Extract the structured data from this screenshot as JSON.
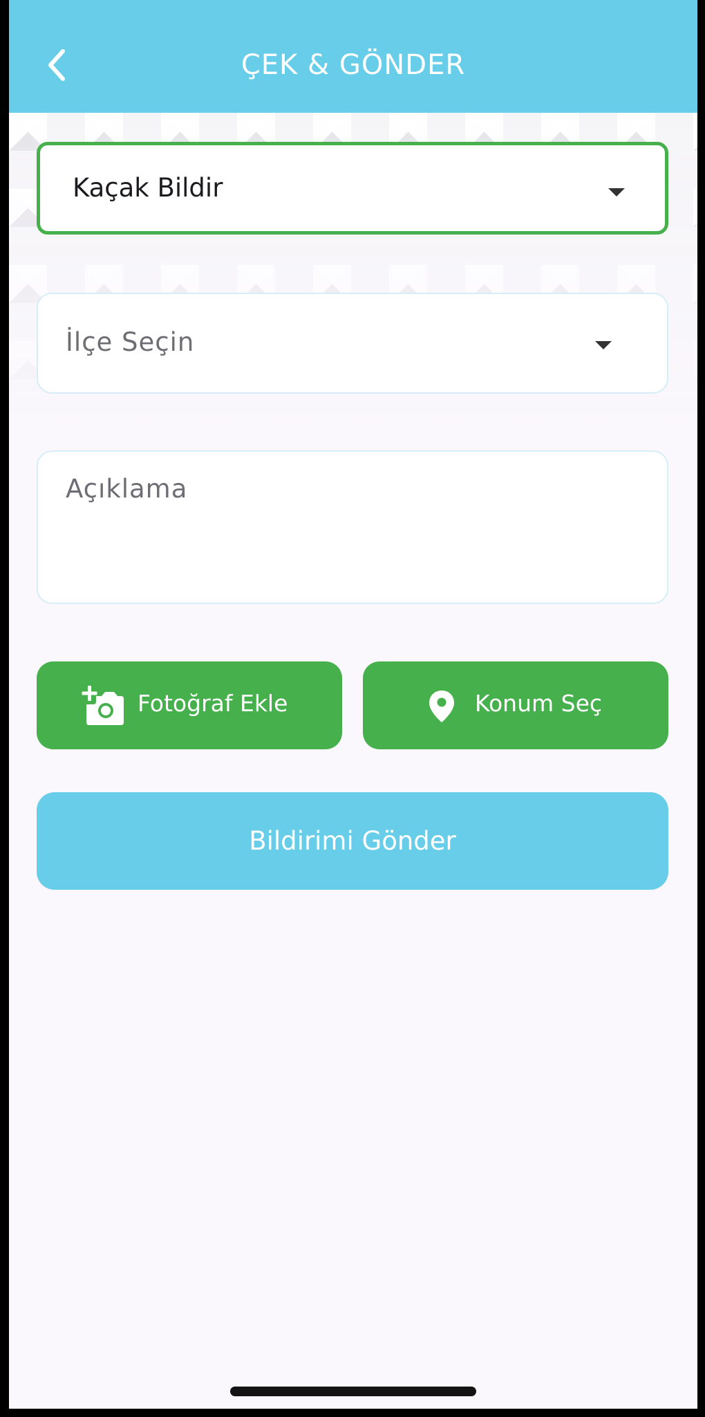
{
  "header": {
    "title": "ÇEK & GÖNDER",
    "back_icon": "chevron-left-icon",
    "background_color": "#67cde9"
  },
  "form": {
    "report_type": {
      "value": "Kaçak Bildir",
      "icon": "dropdown-arrow-icon",
      "border_color": "#46b04c"
    },
    "district": {
      "placeholder": "İlçe Seçin",
      "icon": "dropdown-arrow-icon"
    },
    "description": {
      "placeholder": "Açıklama"
    }
  },
  "actions": {
    "add_photo": {
      "label": "Fotoğraf Ekle",
      "icon": "add-camera-icon"
    },
    "select_location": {
      "label": "Konum Seç",
      "icon": "location-pin-icon"
    },
    "button_color": "#46b04c"
  },
  "submit": {
    "label": "Bildirimi Gönder",
    "color": "#67cde9"
  }
}
